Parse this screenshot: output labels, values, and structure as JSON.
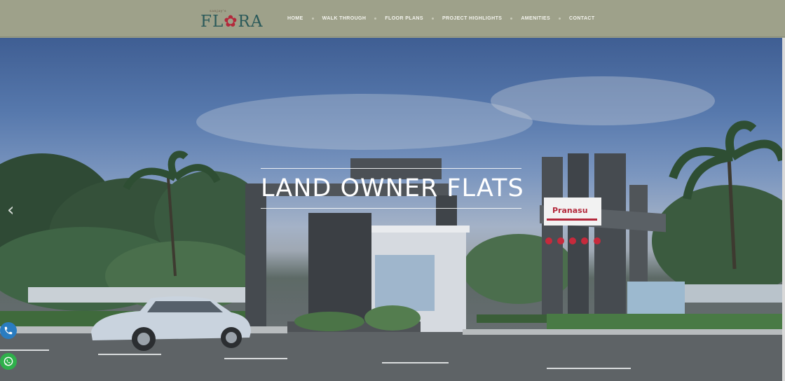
{
  "brand": {
    "tagline": "sanjay's",
    "name_part1": "FL",
    "name_flower": "✿",
    "name_part2": "RA"
  },
  "nav": {
    "items": [
      {
        "label": "Home"
      },
      {
        "label": "Walk Through"
      },
      {
        "label": "Floor Plans"
      },
      {
        "label": "Project Highlights"
      },
      {
        "label": "Amenities"
      },
      {
        "label": "Contact"
      }
    ]
  },
  "hero": {
    "title": "LAND OWNER FLATS",
    "signage": "Pranasu",
    "prev_arrow": "‹"
  },
  "colors": {
    "header_bg": "#9ea18a",
    "nav_text": "#f4f4ee",
    "logo_teal": "#2b5a5a",
    "logo_red": "#b3283b",
    "phone_blue": "#2a7cc0",
    "whatsapp_green": "#2fb04b"
  },
  "icons": {
    "phone": "phone-icon",
    "whatsapp": "whatsapp-icon"
  }
}
